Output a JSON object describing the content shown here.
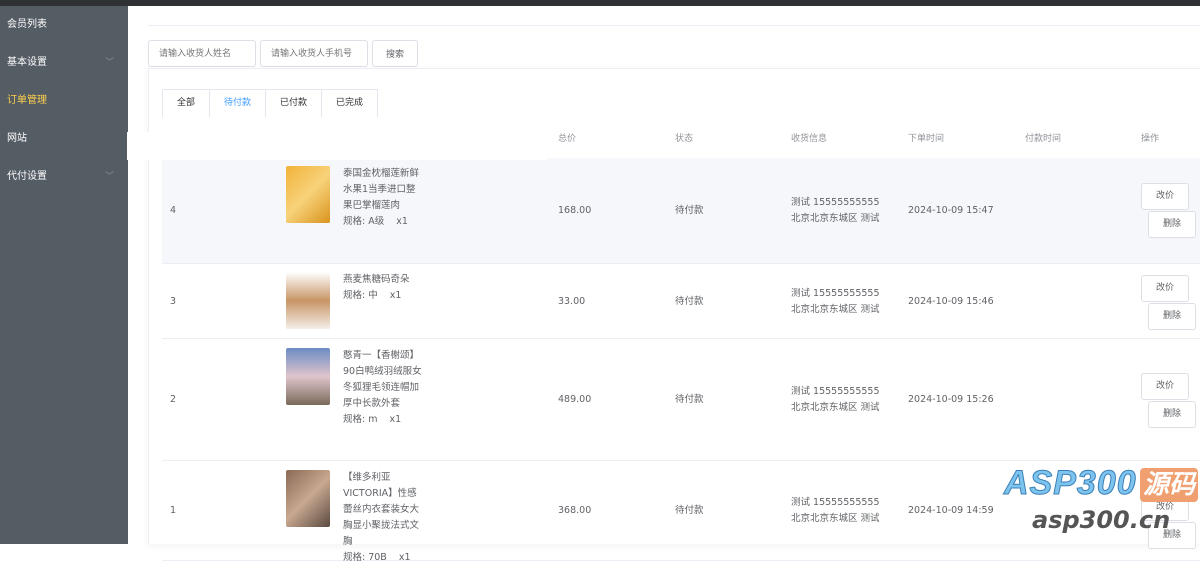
{
  "sidebar": {
    "items": [
      {
        "label": "会员列表"
      },
      {
        "label": "基本设置",
        "has_children": true
      },
      {
        "label": "订单管理",
        "active": true
      },
      {
        "label": "网站"
      },
      {
        "label": "代付设置",
        "has_children": true
      }
    ]
  },
  "search": {
    "name_placeholder": "请输入收货人姓名",
    "phone_placeholder": "请输入收货人手机号",
    "button": "搜索"
  },
  "tabs": [
    {
      "label": "全部"
    },
    {
      "label": "待付款",
      "active": true
    },
    {
      "label": "已付款"
    },
    {
      "label": "已完成"
    }
  ],
  "table": {
    "headers": {
      "total": "总价",
      "status": "状态",
      "shipping": "收货信息",
      "order_time": "下单时间",
      "pay_time": "付款时间",
      "actions": "操作"
    },
    "actions": {
      "edit_price": "改价",
      "delete": "删除"
    },
    "rows": [
      {
        "id": "4",
        "product": "泰国金枕榴莲新鲜水果1当季进口整果巴掌榴莲肉",
        "spec": "规格: A级    x1",
        "total": "168.00",
        "status": "待付款",
        "shipping": "测试 15555555555 北京北京东城区 测试",
        "order_time": "2024-10-09 15:47",
        "pay_time": ""
      },
      {
        "id": "3",
        "product": "燕麦焦糖码奇朵",
        "spec": "规格: 中    x1",
        "total": "33.00",
        "status": "待付款",
        "shipping": "测试 15555555555 北京北京东城区 测试",
        "order_time": "2024-10-09 15:46",
        "pay_time": ""
      },
      {
        "id": "2",
        "product": "憨青一【香榭颂】90白鸭绒羽绒服女冬狐狸毛领连帽加厚中长款外套",
        "spec": "规格: m    x1",
        "total": "489.00",
        "status": "待付款",
        "shipping": "测试 15555555555 北京北京东城区 测试",
        "order_time": "2024-10-09 15:26",
        "pay_time": ""
      },
      {
        "id": "1",
        "product": "【维多利亚 VICTORIA】性感蕾丝内衣套装女大胸显小聚拢法式文胸",
        "spec": "规格: 70B    x1",
        "total": "368.00",
        "status": "待付款",
        "shipping": "测试 15555555555 北京北京东城区 测试",
        "order_time": "2024-10-09 14:59",
        "pay_time": ""
      }
    ]
  },
  "watermark": {
    "brand": "ASP300",
    "tag": "源码",
    "url": "asp300.cn"
  },
  "colors": {
    "sidebar": "#545c64",
    "active_menu": "#ffd04b",
    "active_tab": "#409eff"
  }
}
